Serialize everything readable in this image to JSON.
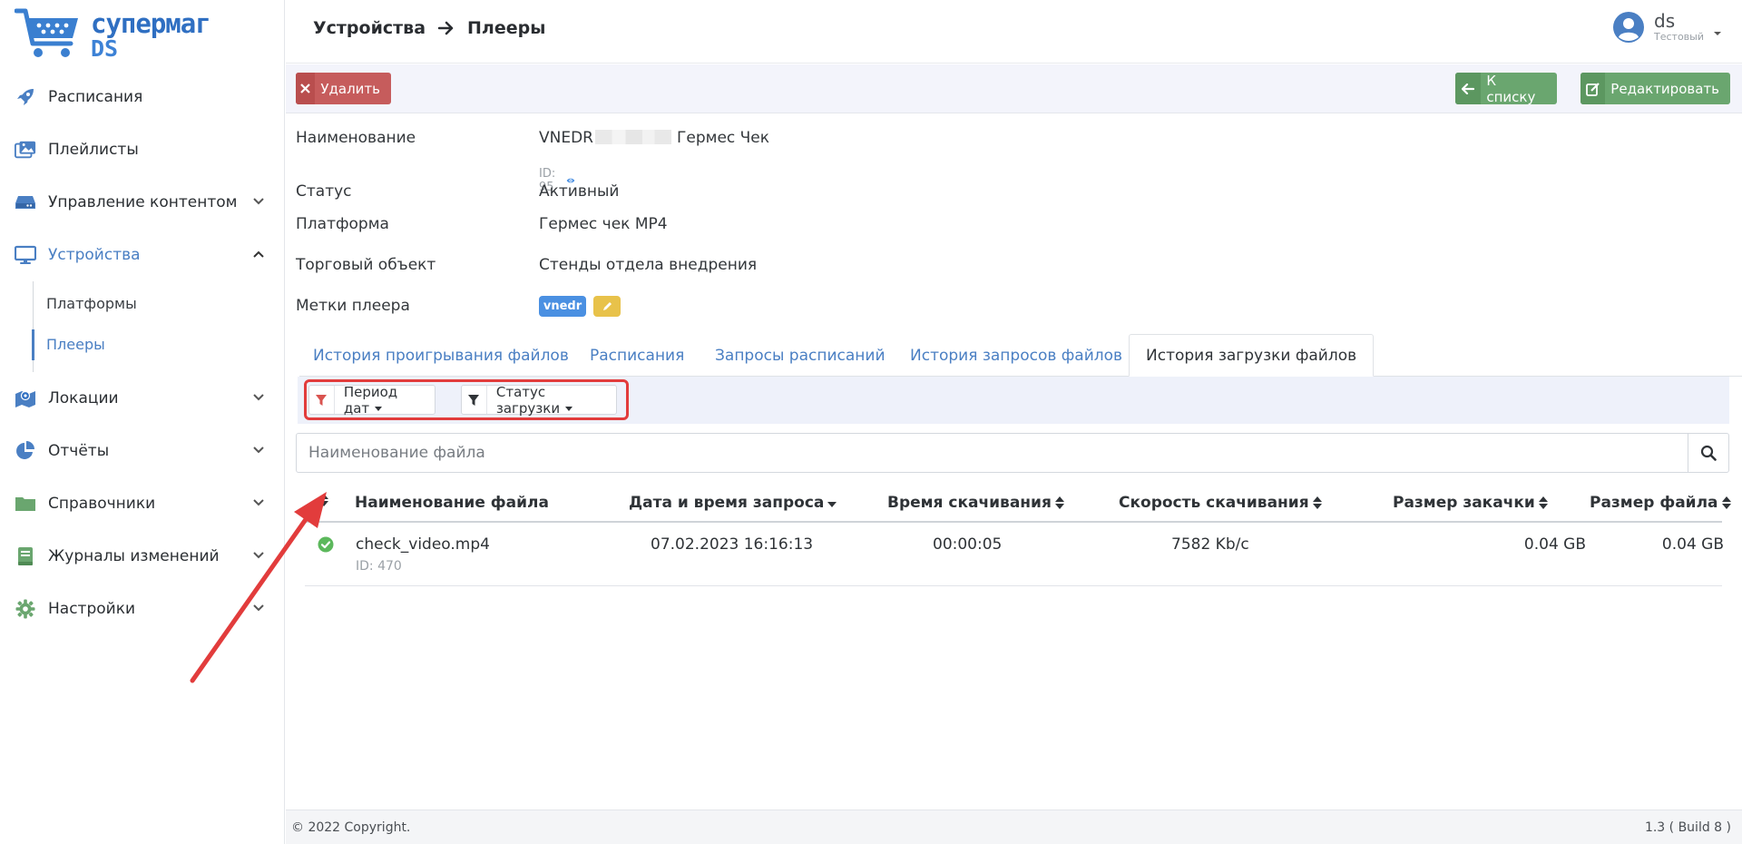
{
  "brand": {
    "line1": "супермаг",
    "line2": "DS",
    "color": "#3a7fd0"
  },
  "sidebar": {
    "items": [
      {
        "label": "Расписания",
        "icon": "rocket-icon"
      },
      {
        "label": "Плейлисты",
        "icon": "images-icon"
      },
      {
        "label": "Управление контентом",
        "icon": "hard-drive-icon"
      },
      {
        "label": "Устройства",
        "icon": "monitor-icon"
      },
      {
        "label": "Локации",
        "icon": "map-icon"
      },
      {
        "label": "Отчёты",
        "icon": "pie-chart-icon"
      },
      {
        "label": "Справочники",
        "icon": "folder-icon"
      },
      {
        "label": "Журналы изменений",
        "icon": "book-icon"
      },
      {
        "label": "Настройки",
        "icon": "gear-icon"
      }
    ],
    "sub_items": [
      {
        "label": "Платформы"
      },
      {
        "label": "Плееры"
      }
    ]
  },
  "header": {
    "breadcrumb": [
      "Устройства",
      "Плееры"
    ],
    "user_name": "ds",
    "user_role": "Тестовый"
  },
  "toolbar": {
    "delete_label": "Удалить",
    "back_label": "К списку",
    "edit_label": "Редактировать"
  },
  "details": {
    "name_label": "Наименование",
    "name_prefix": "VNEDR",
    "name_suffix": "Гермес Чек",
    "id_text": "ID: 95",
    "status_label": "Статус",
    "status_value": "Активный",
    "platform_label": "Платформа",
    "platform_value": "Гермес чек MP4",
    "object_label": "Торговый объект",
    "object_value": "Стенды отдела внедрения",
    "tags_label": "Метки плеера",
    "tag": "vnedr"
  },
  "tabs": [
    {
      "label": "История проигрывания файлов"
    },
    {
      "label": "Расписания"
    },
    {
      "label": "Запросы расписаний"
    },
    {
      "label": "История запросов файлов"
    },
    {
      "label": "История загрузки файлов"
    }
  ],
  "filters": {
    "period_label": "Период дат",
    "status_label": "Статус загрузки"
  },
  "search": {
    "placeholder": "Наименование файла"
  },
  "table": {
    "columns": [
      "Наименование файла",
      "Дата и время запроса",
      "Время скачивания",
      "Скорость скачивания",
      "Размер закачки",
      "Размер файла"
    ],
    "rows": [
      {
        "name": "check_video.mp4",
        "id": "ID: 470",
        "datetime": "07.02.2023 16:16:13",
        "download_time": "00:00:05",
        "speed": "7582 Kb/c",
        "upload_size": "0.04 GB",
        "file_size": "0.04 GB"
      }
    ]
  },
  "footer": {
    "copyright": "© 2022 Copyright.",
    "version": "1.3 ( Build 8 )"
  },
  "colors": {
    "accent": "#4a7fc3",
    "danger": "#c65c5c",
    "success": "#6aa66f",
    "annotation": "#e23c3c"
  }
}
